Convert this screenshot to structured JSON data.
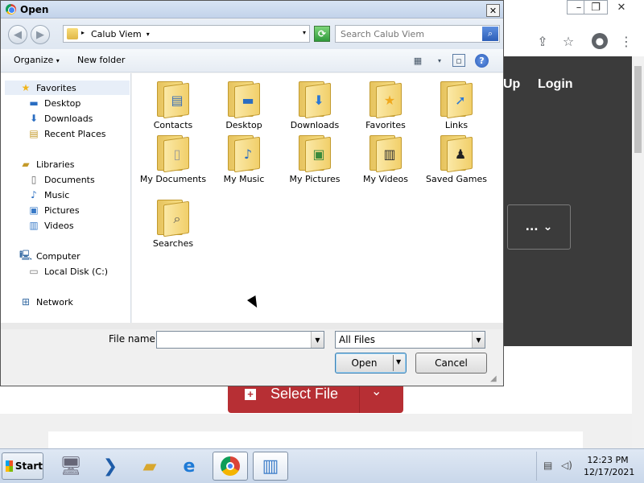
{
  "browser": {
    "nav_links": [
      "Up",
      "Login"
    ],
    "more_button": "...",
    "select_file_label": "Select File"
  },
  "dialog": {
    "title": "Open",
    "path": "Calub Viem",
    "search_placeholder": "Search Calub Viem",
    "toolbar": {
      "organize": "Organize",
      "new_folder": "New folder"
    },
    "nav_tree": {
      "favorites": "Favorites",
      "desktop": "Desktop",
      "downloads": "Downloads",
      "recent_places": "Recent Places",
      "libraries": "Libraries",
      "documents": "Documents",
      "music": "Music",
      "pictures": "Pictures",
      "videos": "Videos",
      "computer": "Computer",
      "local_disk": "Local Disk (C:)",
      "network": "Network"
    },
    "files": [
      {
        "label": "Contacts",
        "icon": "contacts-card"
      },
      {
        "label": "Desktop",
        "icon": "monitor"
      },
      {
        "label": "Downloads",
        "icon": "down-arrow"
      },
      {
        "label": "Favorites",
        "icon": "star"
      },
      {
        "label": "Links",
        "icon": "arrow"
      },
      {
        "label": "My Documents",
        "icon": "document"
      },
      {
        "label": "My Music",
        "icon": "music-note"
      },
      {
        "label": "My Pictures",
        "icon": "picture"
      },
      {
        "label": "My Videos",
        "icon": "film"
      },
      {
        "label": "Saved Games",
        "icon": "chess-piece"
      },
      {
        "label": "Searches",
        "icon": "magnifier"
      }
    ],
    "file_name_label": "File name:",
    "file_name_value": "",
    "file_type": "All Files",
    "open_button": "Open",
    "cancel_button": "Cancel"
  },
  "taskbar": {
    "start_label": "Start",
    "time": "12:23 PM",
    "date": "12/17/2021"
  }
}
